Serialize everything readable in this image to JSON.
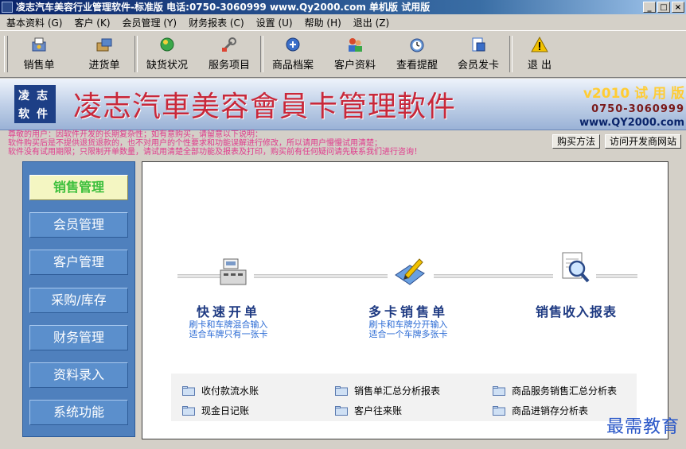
{
  "window": {
    "title": "凌志汽车美容行业管理软件-标准版   电话:0750-3060999  www.Qy2000.com   单机版  试用版",
    "controls": [
      "_",
      "□",
      "×"
    ]
  },
  "menu": [
    "基本资料 (G)",
    "客户 (K)",
    "会员管理 (Y)",
    "财务报表 (C)",
    "设置 (U)",
    "帮助 (H)",
    "退出 (Z)"
  ],
  "toolbar": [
    {
      "label": "销售单",
      "icon": "sales-slip-icon"
    },
    {
      "label": "进货单",
      "icon": "purchase-slip-icon"
    },
    {
      "label": "缺货状况",
      "icon": "shortage-icon"
    },
    {
      "label": "服务项目",
      "icon": "service-tools-icon"
    },
    {
      "label": "商品档案",
      "icon": "product-archive-icon"
    },
    {
      "label": "客户资料",
      "icon": "customers-icon"
    },
    {
      "label": "查看提醒",
      "icon": "alarm-clock-icon"
    },
    {
      "label": "会员发卡",
      "icon": "member-card-icon"
    },
    {
      "label": "退  出",
      "icon": "warning-exit-icon"
    }
  ],
  "banner": {
    "logo": [
      "凌",
      "志",
      "软",
      "件"
    ],
    "title": "凌志汽車美容會員卡管理軟件",
    "version": "v2010 试 用 版",
    "phone": "0750-3060999",
    "website": "www.QY2000.com"
  },
  "notice": [
    "尊敬的用户：因软件开发的长期复杂性；如有意购买，请留意以下说明：",
    "软件购买后是不提供退货退款的，也不对用户的个性要求和功能误解进行修改，所以请用户慢慢试用清楚；",
    "软件没有试用期限；只限制开单数量，请试用清楚全部功能及报表及打印，购买前有任何疑问请先联系我们进行咨询！"
  ],
  "buttons": {
    "buy": "购买方法",
    "visit": "访问开发商网站"
  },
  "sidebar": [
    "销售管理",
    "会员管理",
    "客户管理",
    "采购/库存",
    "财务管理",
    "资料录入",
    "系统功能"
  ],
  "features": [
    {
      "title": "快速开单",
      "lines": [
        "刷卡和车牌混合输入",
        "适合车牌只有一张卡"
      ],
      "icon": "cash-register-icon"
    },
    {
      "title": "多卡销售单",
      "lines": [
        "刷卡和车牌分开输入",
        "适合一个车牌多张卡"
      ],
      "icon": "pen-document-icon"
    },
    {
      "title": "销售收入报表",
      "lines": [],
      "icon": "magnifier-report-icon"
    }
  ],
  "links": [
    "收付款流水账",
    "销售单汇总分析报表",
    "商品服务销售汇总分析表",
    "现金日记账",
    "客户往来账",
    "商品进销存分析表"
  ],
  "watermark": "最需教育",
  "colors": {
    "accent": "#0a246a",
    "banner_title": "#c8283a",
    "sidebar": "#4f80bd",
    "notice": "#e03a8c",
    "feature_title": "#1e3a82"
  }
}
